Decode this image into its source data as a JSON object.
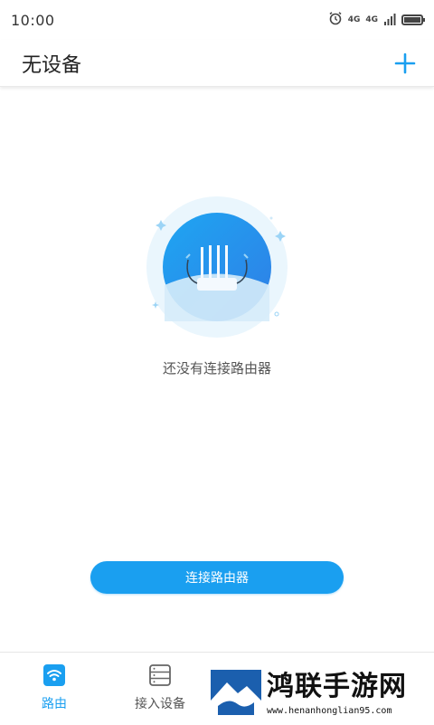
{
  "status_bar": {
    "time": "10:00",
    "net_label_1": "4G",
    "net_label_2": "4G",
    "icons": [
      "alarm-icon",
      "signal-icon",
      "battery-icon"
    ]
  },
  "header": {
    "title": "无设备",
    "add_icon": "plus-icon"
  },
  "empty_state": {
    "illustration": "router-icon",
    "message": "还没有连接路由器"
  },
  "actions": {
    "connect_label": "连接路由器"
  },
  "bottom_nav": {
    "items": [
      {
        "label": "路由",
        "icon": "wifi-icon",
        "active": true
      },
      {
        "label": "接入设备",
        "icon": "server-list-icon",
        "active": false
      }
    ]
  },
  "watermark": {
    "title": "鸿联手游网",
    "url": "www.henanhonglian95.com"
  },
  "colors": {
    "accent": "#1a9ff0",
    "text_primary": "#222222",
    "text_secondary": "#555555"
  }
}
